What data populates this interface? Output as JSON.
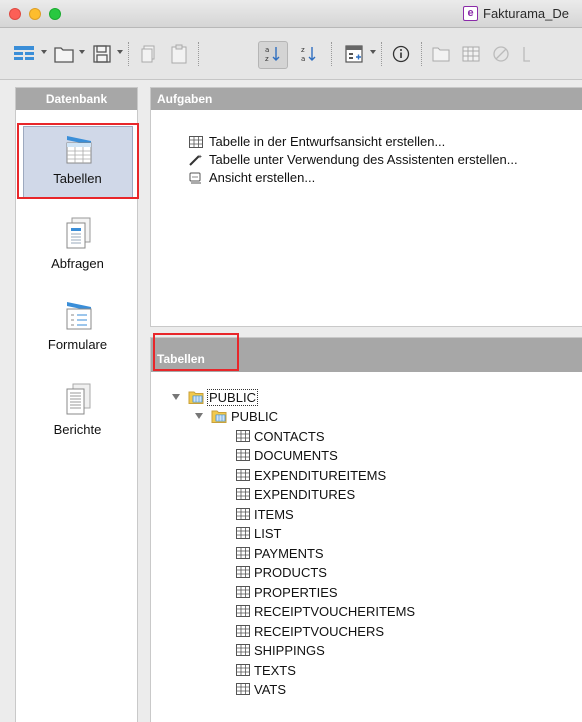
{
  "window": {
    "title": "Fakturama_De",
    "app_icon": "base-document-icon"
  },
  "toolbar": {
    "buttons": [
      "new-form-icon",
      "open-icon",
      "save-icon",
      "copy-icon",
      "paste-icon",
      "sort-ascending-icon",
      "sort-descending-icon",
      "form-design-icon",
      "info-icon",
      "folder-icon",
      "table-icon",
      "stop-icon",
      "bracket-icon"
    ]
  },
  "sidebar": {
    "header": "Datenbank",
    "items": [
      {
        "label": "Tabellen",
        "icon": "tables-icon",
        "selected": true
      },
      {
        "label": "Abfragen",
        "icon": "queries-icon",
        "selected": false
      },
      {
        "label": "Formulare",
        "icon": "forms-icon",
        "selected": false
      },
      {
        "label": "Berichte",
        "icon": "reports-icon",
        "selected": false
      }
    ]
  },
  "tasks": {
    "header": "Aufgaben",
    "items": [
      {
        "label": "Tabelle in der Entwurfsansicht erstellen...",
        "icon": "table-design-icon"
      },
      {
        "label": "Tabelle unter Verwendung des Assistenten erstellen...",
        "icon": "wizard-wand-icon"
      },
      {
        "label": "Ansicht erstellen...",
        "icon": "view-icon"
      }
    ]
  },
  "tables_panel": {
    "header": "Tabellen",
    "root": "PUBLIC",
    "schema": "PUBLIC",
    "tables": [
      "CONTACTS",
      "DOCUMENTS",
      "EXPENDITUREITEMS",
      "EXPENDITURES",
      "ITEMS",
      "LIST",
      "PAYMENTS",
      "PRODUCTS",
      "PROPERTIES",
      "RECEIPTVOUCHERITEMS",
      "RECEIPTVOUCHERS",
      "SHIPPINGS",
      "TEXTS",
      "VATS"
    ]
  },
  "colors": {
    "highlight": "#e8262a",
    "panel_header": "#a7a7a7",
    "selection": "#d0d8e8"
  }
}
